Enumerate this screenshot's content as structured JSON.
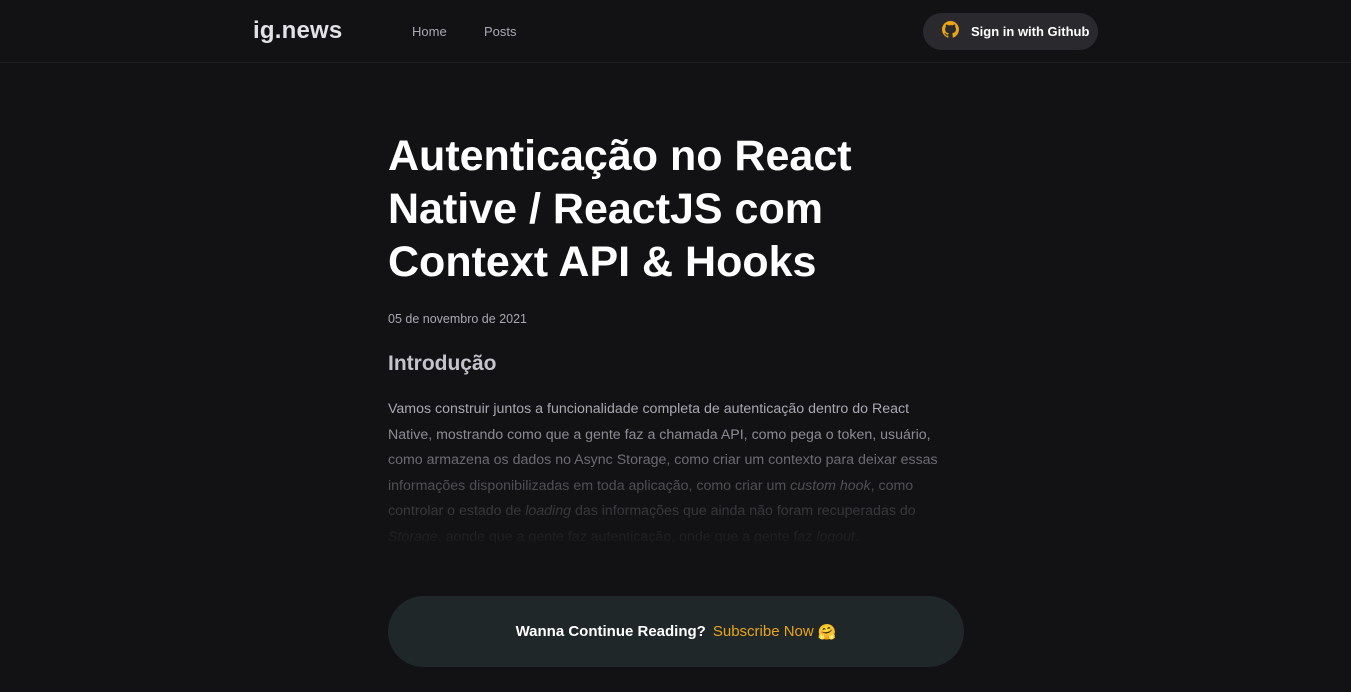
{
  "header": {
    "logo": "ig.news",
    "nav": [
      {
        "label": "Home"
      },
      {
        "label": "Posts"
      }
    ],
    "signin_label": "Sign in with Github",
    "signin_icon": "github-icon",
    "signin_icon_color": "#eba417"
  },
  "post": {
    "title": "Autenticação no React Native / ReactJS com Context API & Hooks",
    "date": "05 de novembro de 2021",
    "heading": "Introdução",
    "p1": "Vamos construir juntos a funcionalidade completa de autenticação dentro do React Native, mostrando como que a gente faz a chamada API, como pega o token, usuário, como armazena os dados no Async Storage, como criar um contexto para deixar essas informações disponibilizadas em toda aplicação, como  criar um ",
    "em1": "custom hook",
    "p2": ", como controlar o estado de ",
    "em2": "loading",
    "p3": " das informações que ainda não foram recuperadas do ",
    "em3": "Storage",
    "p4": ", aonde que a gente faz autenticação, onde que a gente faz ",
    "em4": "logout",
    "p5": "."
  },
  "cta": {
    "text": "Wanna Continue Reading?",
    "link": "Subscribe Now",
    "emoji": "🤗"
  },
  "colors": {
    "background": "#121214",
    "accent": "#eba417",
    "cta_background": "#1f2729"
  }
}
